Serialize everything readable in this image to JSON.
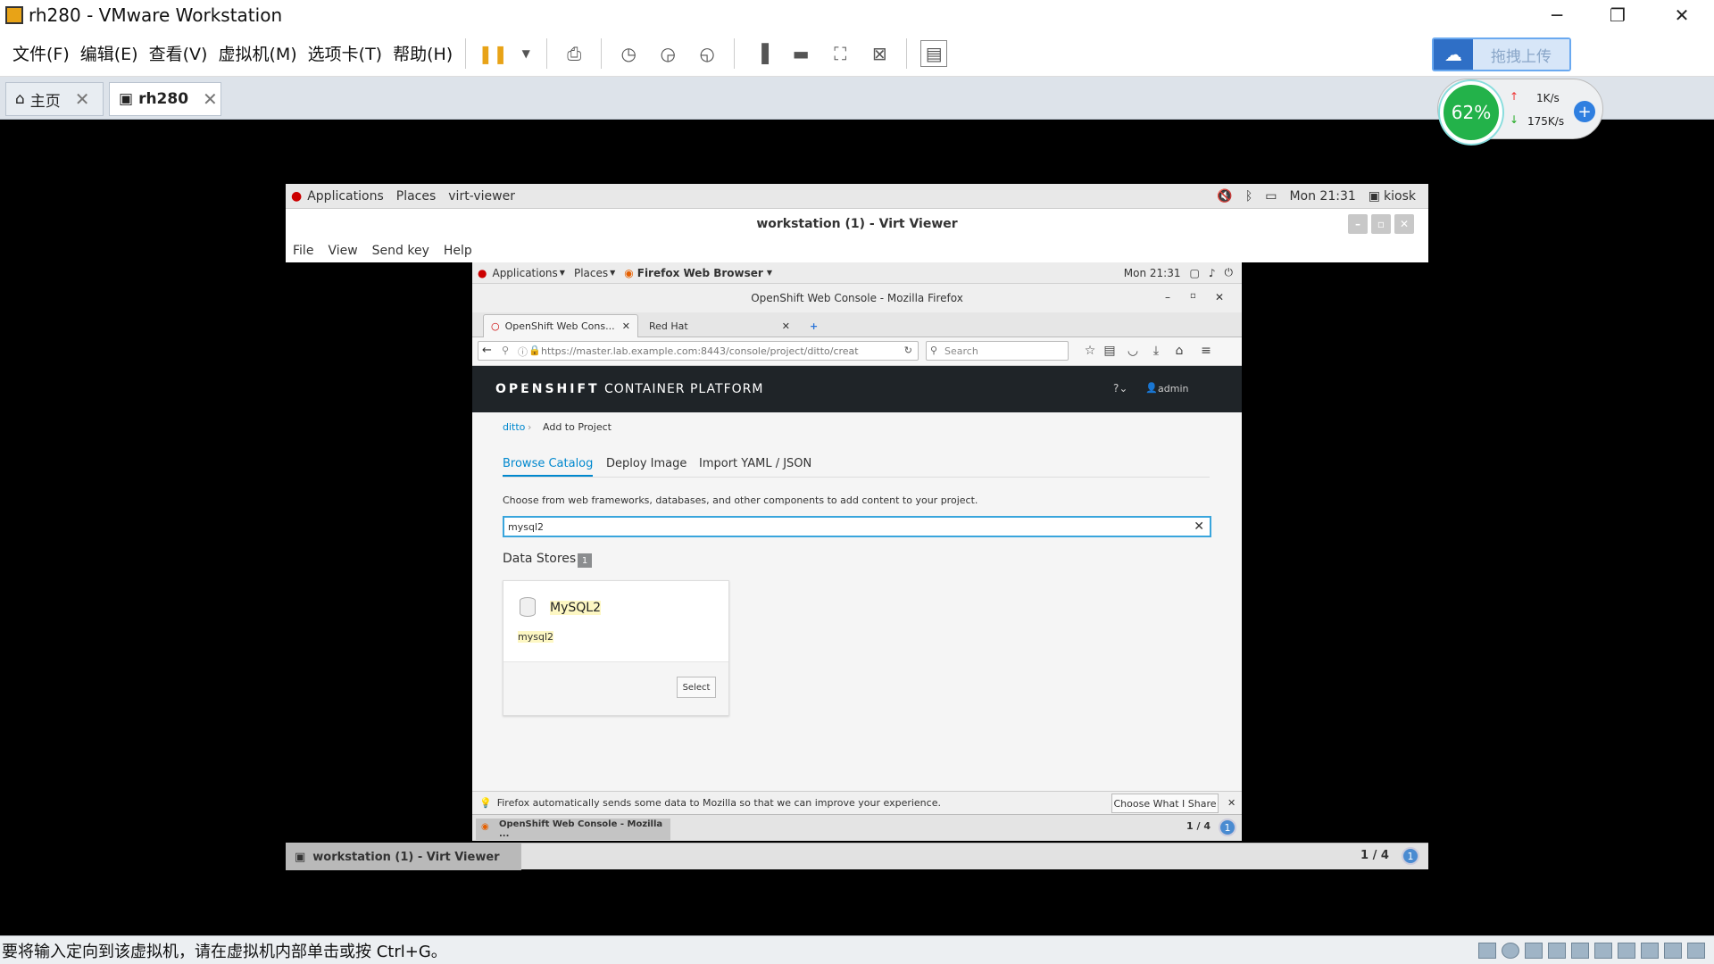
{
  "vmware": {
    "title": "rh280 - VMware Workstation",
    "menu": [
      "文件(F)",
      "编辑(E)",
      "查看(V)",
      "虚拟机(M)",
      "选项卡(T)",
      "帮助(H)"
    ],
    "tabs": [
      {
        "label": "主页"
      },
      {
        "label": "rh280"
      }
    ],
    "status_message": "要将输入定向到该虚拟机，请在虚拟机内部单击或按 Ctrl+G。"
  },
  "overlay": {
    "upload_label": "拖拽上传",
    "percent": "62%",
    "upload_speed": "1K/s",
    "download_speed": "175K/s"
  },
  "guest_topbar": {
    "applications": "Applications",
    "places": "Places",
    "window": "virt-viewer",
    "clock": "Mon 21:31",
    "user": "kiosk"
  },
  "virt_viewer": {
    "title": "workstation (1) - Virt Viewer",
    "menu": [
      "File",
      "View",
      "Send key",
      "Help"
    ],
    "taskbar_label": "workstation (1) - Virt Viewer",
    "pager": "1 / 4"
  },
  "inner_topbar": {
    "applications": "Applications",
    "places": "Places",
    "window": "Firefox Web Browser",
    "clock": "Mon 21:31"
  },
  "firefox": {
    "title": "OpenShift Web Console - Mozilla Firefox",
    "tabs": [
      {
        "label": "OpenShift Web Cons..."
      },
      {
        "label": "Red Hat"
      }
    ],
    "url": "https://master.lab.example.com:8443/console/project/ditto/creat",
    "search_placeholder": "Search",
    "notice": "Firefox automatically sends some data to Mozilla so that we can improve your experience.",
    "notice_button": "Choose What I Share",
    "taskbar_label": "OpenShift Web Console - Mozilla ...",
    "pager": "1 / 4"
  },
  "openshift": {
    "brand_bold": "OPENSHIFT",
    "brand_rest": "CONTAINER PLATFORM",
    "user": "admin",
    "breadcrumb": [
      "ditto",
      "Add to Project"
    ],
    "tabs": [
      "Browse Catalog",
      "Deploy Image",
      "Import YAML / JSON"
    ],
    "description": "Choose from web frameworks, databases, and other components to add content to your project.",
    "filter_value": "mysql2",
    "section_title": "Data Stores",
    "section_count": "1",
    "card": {
      "name": "MySQL2",
      "tag": "mysql2",
      "button": "Select"
    }
  }
}
